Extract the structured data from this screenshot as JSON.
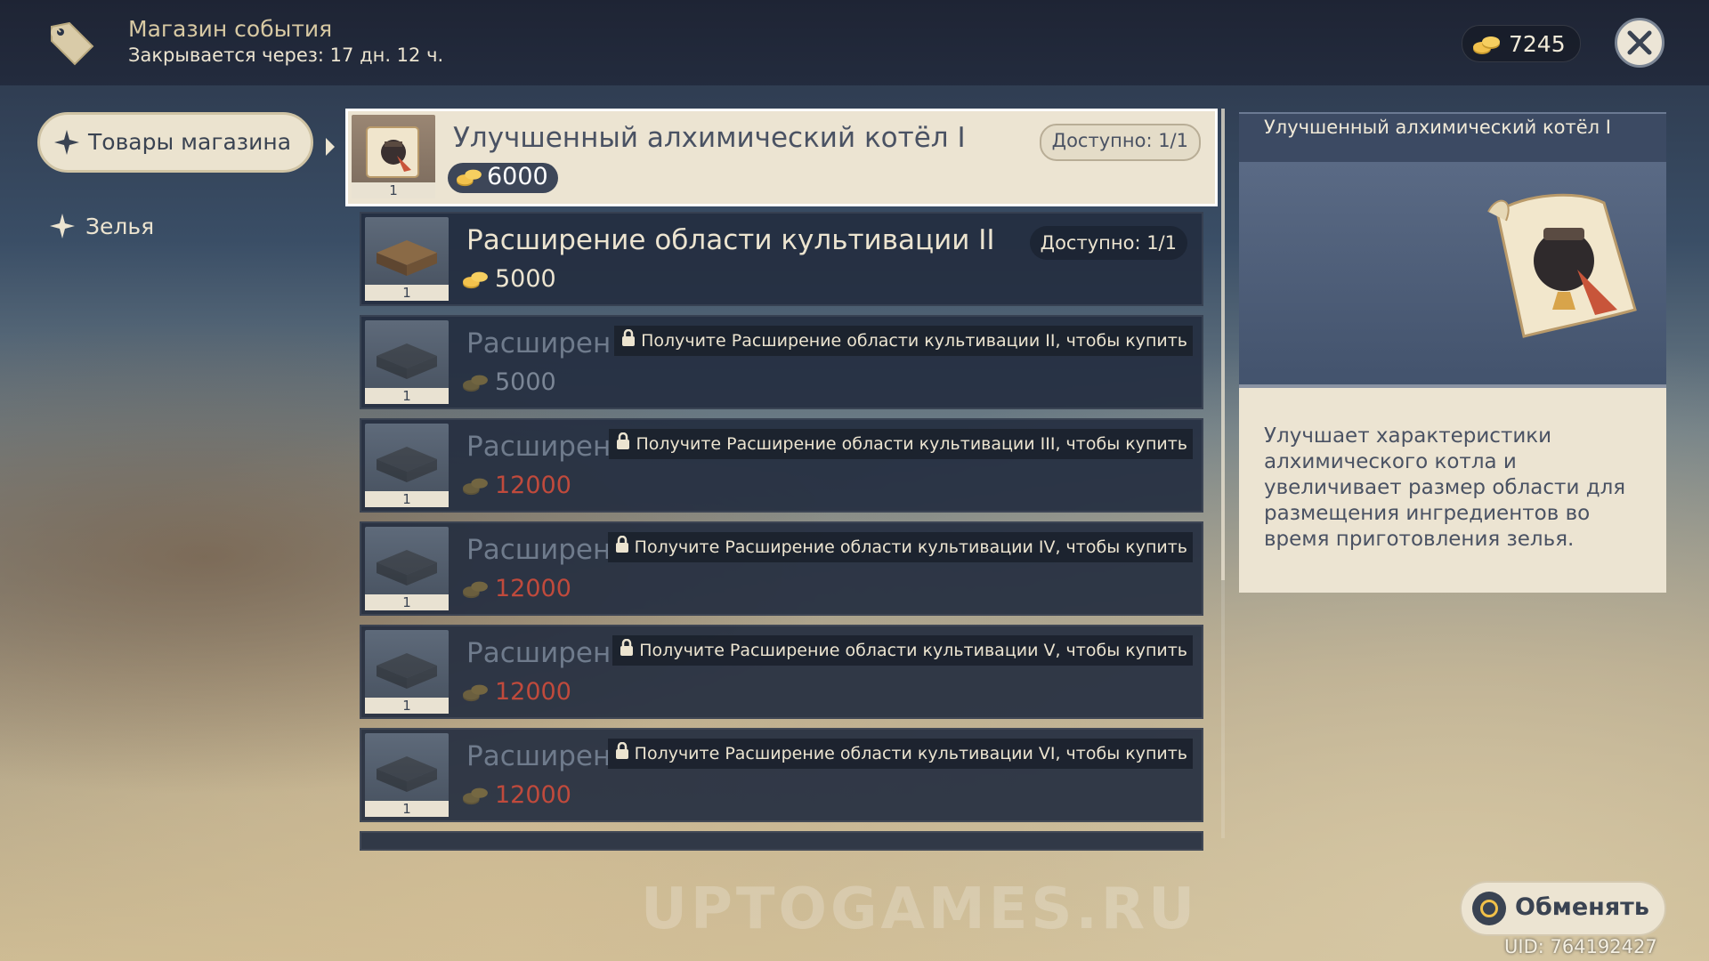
{
  "header": {
    "title": "Магазин события",
    "subtitle": "Закрывается через: 17 дн. 12 ч.",
    "currency_value": "7245"
  },
  "categories": [
    {
      "label": "Товары магазина",
      "active": true
    },
    {
      "label": "Зелья",
      "active": false
    }
  ],
  "items": [
    {
      "name": "Улучшенный алхимический котёл I",
      "price": "6000",
      "qty": "1",
      "available": "Доступно: 1/1",
      "selected": true
    },
    {
      "name": "Расширение области культивации II",
      "price": "5000",
      "qty": "1",
      "available": "Доступно: 1/1"
    },
    {
      "name": "Расширен",
      "price": "5000",
      "qty": "1",
      "lock": "Получите Расширение области культивации II, чтобы купить"
    },
    {
      "name": "Расширен",
      "price": "12000",
      "qty": "1",
      "lock": "Получите Расширение области культивации III, чтобы купить"
    },
    {
      "name": "Расширен",
      "price": "12000",
      "qty": "1",
      "lock": "Получите Расширение области культивации IV, чтобы купить"
    },
    {
      "name": "Расширен",
      "price": "12000",
      "qty": "1",
      "lock": "Получите Расширение области культивации V, чтобы купить"
    },
    {
      "name": "Расширен",
      "price": "12000",
      "qty": "1",
      "lock": "Получите Расширение области культивации VI, чтобы купить"
    }
  ],
  "detail": {
    "title": "Улучшенный алхимический котёл I",
    "description": "Улучшает характеристики алхимического котла и увеличивает размер области для размещения ингредиентов во время приготовления зелья."
  },
  "footer": {
    "exchange_label": "Обменять",
    "uid": "UID: 764192427",
    "watermark": "UPTOGAMES.RU"
  },
  "colors": {
    "accent": "#ece4d2",
    "panel": "#242e40",
    "locked_price": "#c04a3c"
  },
  "icons": [
    "shop-tag-icon",
    "coin-icon",
    "close-icon",
    "star-icon",
    "lock-icon",
    "scroll-icon",
    "crate-icon"
  ]
}
